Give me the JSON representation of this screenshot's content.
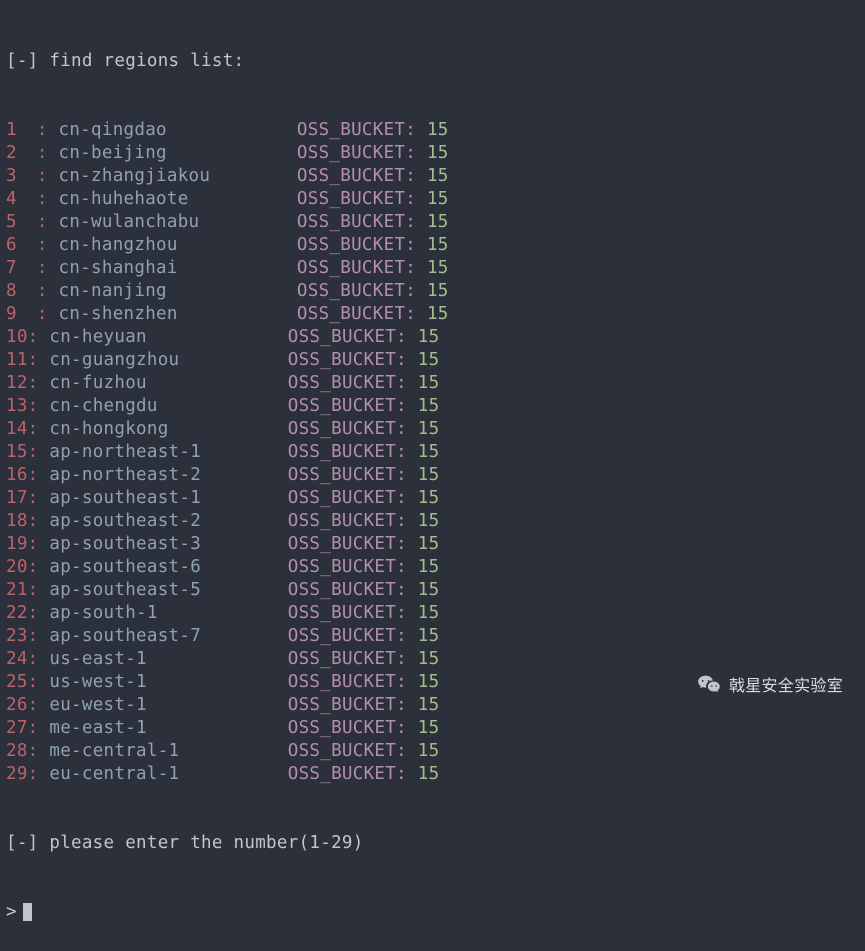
{
  "header": {
    "text": "[-] find regions list:"
  },
  "bucket_label": "OSS_BUCKET",
  "regions": [
    {
      "idx": "1",
      "sep": " :",
      "name": "cn-qingdao",
      "bucket": "15"
    },
    {
      "idx": "2",
      "sep": " :",
      "name": "cn-beijing",
      "bucket": "15"
    },
    {
      "idx": "3",
      "sep": " :",
      "name": "cn-zhangjiakou",
      "bucket": "15"
    },
    {
      "idx": "4",
      "sep": " :",
      "name": "cn-huhehaote",
      "bucket": "15"
    },
    {
      "idx": "5",
      "sep": " :",
      "name": "cn-wulanchabu",
      "bucket": "15"
    },
    {
      "idx": "6",
      "sep": " :",
      "name": "cn-hangzhou",
      "bucket": "15"
    },
    {
      "idx": "7",
      "sep": " :",
      "name": "cn-shanghai",
      "bucket": "15"
    },
    {
      "idx": "8",
      "sep": " :",
      "name": "cn-nanjing",
      "bucket": "15"
    },
    {
      "idx": "9",
      "sep": " :",
      "name": "cn-shenzhen",
      "bucket": "15"
    },
    {
      "idx": "10",
      "sep": ":",
      "name": "cn-heyuan",
      "bucket": "15"
    },
    {
      "idx": "11",
      "sep": ":",
      "name": "cn-guangzhou",
      "bucket": "15"
    },
    {
      "idx": "12",
      "sep": ":",
      "name": "cn-fuzhou",
      "bucket": "15"
    },
    {
      "idx": "13",
      "sep": ":",
      "name": "cn-chengdu",
      "bucket": "15"
    },
    {
      "idx": "14",
      "sep": ":",
      "name": "cn-hongkong",
      "bucket": "15"
    },
    {
      "idx": "15",
      "sep": ":",
      "name": "ap-northeast-1",
      "bucket": "15"
    },
    {
      "idx": "16",
      "sep": ":",
      "name": "ap-northeast-2",
      "bucket": "15"
    },
    {
      "idx": "17",
      "sep": ":",
      "name": "ap-southeast-1",
      "bucket": "15"
    },
    {
      "idx": "18",
      "sep": ":",
      "name": "ap-southeast-2",
      "bucket": "15"
    },
    {
      "idx": "19",
      "sep": ":",
      "name": "ap-southeast-3",
      "bucket": "15"
    },
    {
      "idx": "20",
      "sep": ":",
      "name": "ap-southeast-6",
      "bucket": "15"
    },
    {
      "idx": "21",
      "sep": ":",
      "name": "ap-southeast-5",
      "bucket": "15"
    },
    {
      "idx": "22",
      "sep": ":",
      "name": "ap-south-1",
      "bucket": "15"
    },
    {
      "idx": "23",
      "sep": ":",
      "name": "ap-southeast-7",
      "bucket": "15"
    },
    {
      "idx": "24",
      "sep": ":",
      "name": "us-east-1",
      "bucket": "15"
    },
    {
      "idx": "25",
      "sep": ":",
      "name": "us-west-1",
      "bucket": "15"
    },
    {
      "idx": "26",
      "sep": ":",
      "name": "eu-west-1",
      "bucket": "15"
    },
    {
      "idx": "27",
      "sep": ":",
      "name": "me-east-1",
      "bucket": "15"
    },
    {
      "idx": "28",
      "sep": ":",
      "name": "me-central-1",
      "bucket": "15"
    },
    {
      "idx": "29",
      "sep": ":",
      "name": "eu-central-1",
      "bucket": "15"
    }
  ],
  "prompt": {
    "text": "[-] please enter the number(1-29)"
  },
  "watermark": {
    "text": "戟星安全实验室"
  }
}
